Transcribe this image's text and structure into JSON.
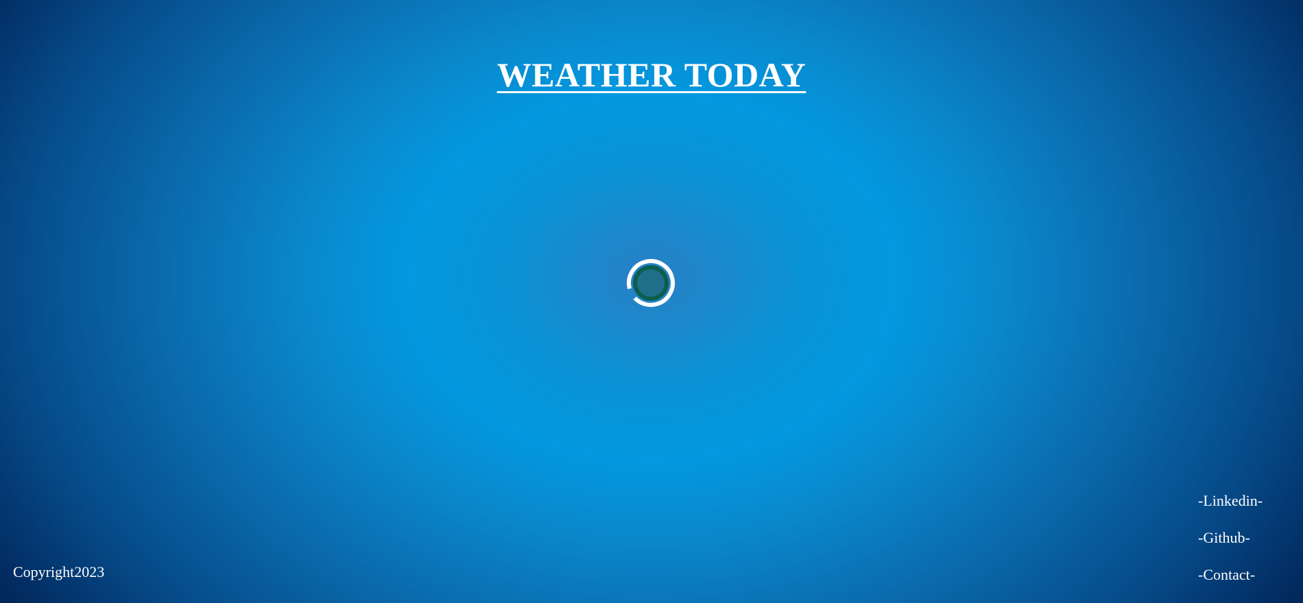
{
  "page": {
    "title": "WEATHER TODAY"
  },
  "loader": {
    "icon": "loading-spinner-icon",
    "ring_color": "#ffffff",
    "inner_color": "#0b5e4e"
  },
  "footer": {
    "copyright": "Copyright2023",
    "links": [
      {
        "label": "-Linkedin-"
      },
      {
        "label": "-Github-"
      },
      {
        "label": "-Contact-"
      }
    ]
  },
  "colors": {
    "background_center": "#0398df",
    "background_edge": "#011e4c",
    "text": "#ffffff"
  }
}
